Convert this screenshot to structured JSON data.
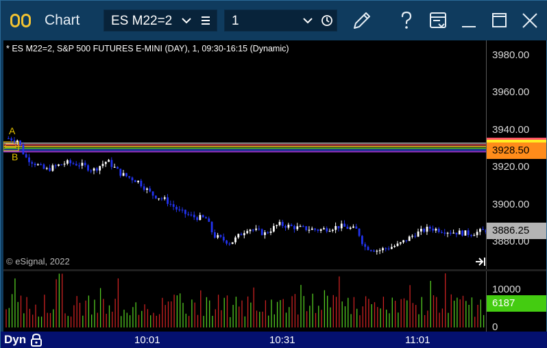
{
  "app": {
    "title": "Chart"
  },
  "toolbar": {
    "symbol_value": "ES M22=2",
    "interval_value": "1"
  },
  "chart": {
    "header": "* ES M22=2, S&P 500 FUTURES E-MINI (DAY), 1, 09:30-16:15 (Dynamic)",
    "copyright": "© eSignal, 2022",
    "marker_a": "A",
    "marker_b": "B",
    "price_axis_labels": [
      "3980.00",
      "3960.00",
      "3940.00",
      "3920.00",
      "3900.00",
      "3880.00"
    ],
    "highlight_price": "3928.50",
    "last_price": "3886.25",
    "volume_axis_labels": [
      "10000",
      "0"
    ],
    "last_volume": "6187",
    "time_labels": [
      "10:01",
      "10:31",
      "11:01"
    ],
    "mode_label": "Dyn"
  },
  "colors": {
    "background": "#000000",
    "window_frame": "#0f3b5e",
    "up_candle": "#ffffff",
    "down_candle": "#2233ee",
    "highlight_box": "#ff8c1a",
    "last_price_box": "#b4b4b4",
    "volume_box": "#44cc11",
    "timebar": "#04106e"
  }
}
